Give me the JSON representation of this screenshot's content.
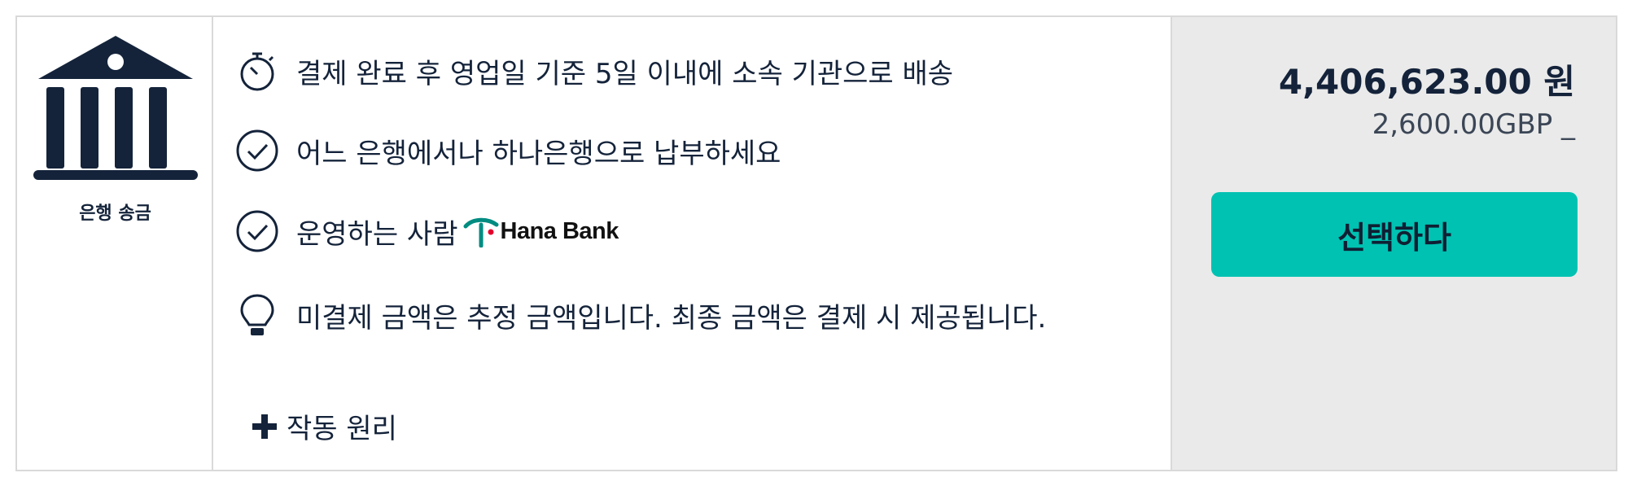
{
  "method": {
    "label": "은행 송금",
    "icon": "bank-building-icon"
  },
  "info": {
    "delivery": "결제 완료 후 영업일 기준 5일 이내에 소속 기관으로 배송",
    "any_bank": "어느 은행에서나 하나은행으로 납부하세요",
    "operated_by": "운영하는 사람",
    "operator_logo_text": "Hana Bank",
    "estimate_note": "미결제 금액은 추정 금액입니다. 최종 금액은 결제 시 제공됩니다."
  },
  "how_it_works": {
    "label": "작동 원리"
  },
  "price": {
    "amount": "4,406,623.00 원",
    "original": "2,600.00GBP _"
  },
  "actions": {
    "select_label": "선택하다"
  },
  "colors": {
    "accent": "#00c2b2",
    "text": "#14233a",
    "panel": "#eaeaea",
    "hana_green": "#008c81",
    "hana_red": "#e4002b"
  }
}
